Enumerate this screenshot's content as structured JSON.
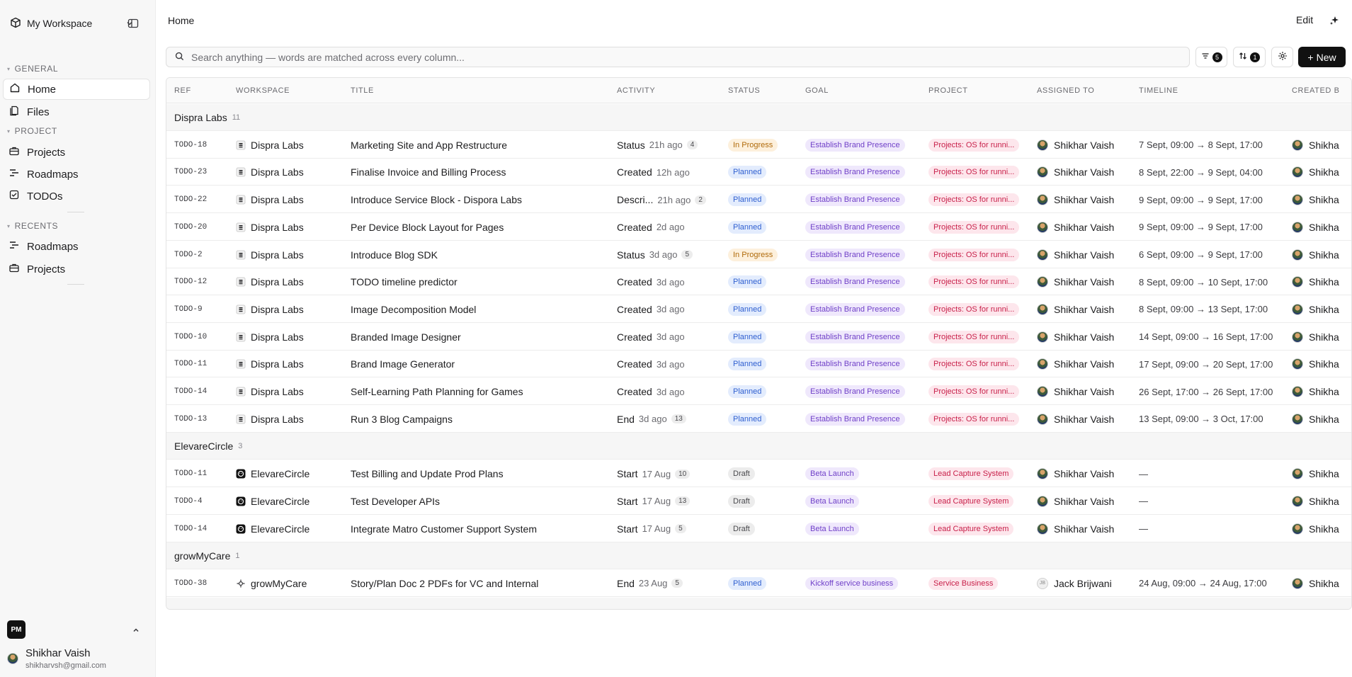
{
  "sidebar": {
    "workspace_name": "My Workspace",
    "sections": {
      "general": "GENERAL",
      "project": "PROJECT",
      "recents": "RECENTS"
    },
    "general_items": [
      {
        "label": "Home",
        "icon": "home-icon",
        "active": true
      },
      {
        "label": "Files",
        "icon": "files-icon"
      }
    ],
    "project_items": [
      {
        "label": "Projects",
        "icon": "briefcase-icon"
      },
      {
        "label": "Roadmaps",
        "icon": "roadmap-icon"
      },
      {
        "label": "TODOs",
        "icon": "checkbox-icon"
      }
    ],
    "recent_items": [
      {
        "label": "Roadmaps",
        "icon": "roadmap-icon"
      },
      {
        "label": "Projects",
        "icon": "briefcase-icon"
      }
    ],
    "org_badge": "PM",
    "user": {
      "name": "Shikhar Vaish",
      "email": "shikharvsh@gmail.com"
    }
  },
  "header": {
    "title": "Home",
    "edit_label": "Edit"
  },
  "toolbar": {
    "search_placeholder": "Search anything — words are matched across every column...",
    "filter_count": "5",
    "sort_count": "1",
    "new_label": "New"
  },
  "columns": {
    "ref": "REF",
    "workspace": "WORKSPACE",
    "title": "TITLE",
    "activity": "ACTIVITY",
    "status": "STATUS",
    "goal": "GOAL",
    "project": "PROJECT",
    "assigned": "ASSIGNED TO",
    "timeline": "TIMELINE",
    "created": "CREATED B"
  },
  "groups": [
    {
      "name": "Dispra Labs",
      "count": "11",
      "rows": [
        {
          "ref": "TODO-18",
          "workspace": "Dispra Labs",
          "title": "Marketing Site and App Restructure",
          "activity": "Status",
          "when": "21h ago",
          "n": "4",
          "status": "In Progress",
          "status_kind": "inprogress",
          "goal": "Establish Brand Presence",
          "project": "Projects: OS for runni...",
          "assigned": "Shikhar Vaish",
          "timeline": "7 Sept, 09:00 → 8 Sept, 17:00",
          "created": "Shikha"
        },
        {
          "ref": "TODO-23",
          "workspace": "Dispra Labs",
          "title": "Finalise Invoice and Billing Process",
          "activity": "Created",
          "when": "12h ago",
          "n": "",
          "status": "Planned",
          "status_kind": "planned",
          "goal": "Establish Brand Presence",
          "project": "Projects: OS for runni...",
          "assigned": "Shikhar Vaish",
          "timeline": "8 Sept, 22:00 → 9 Sept, 04:00",
          "created": "Shikha"
        },
        {
          "ref": "TODO-22",
          "workspace": "Dispra Labs",
          "title": "Introduce Service Block - Dispora Labs",
          "activity": "Descri...",
          "when": "21h ago",
          "n": "2",
          "status": "Planned",
          "status_kind": "planned",
          "goal": "Establish Brand Presence",
          "project": "Projects: OS for runni...",
          "assigned": "Shikhar Vaish",
          "timeline": "9 Sept, 09:00 → 9 Sept, 17:00",
          "created": "Shikha"
        },
        {
          "ref": "TODO-20",
          "workspace": "Dispra Labs",
          "title": "Per Device Block Layout for Pages",
          "activity": "Created",
          "when": "2d ago",
          "n": "",
          "status": "Planned",
          "status_kind": "planned",
          "goal": "Establish Brand Presence",
          "project": "Projects: OS for runni...",
          "assigned": "Shikhar Vaish",
          "timeline": "9 Sept, 09:00 → 9 Sept, 17:00",
          "created": "Shikha"
        },
        {
          "ref": "TODO-2",
          "workspace": "Dispra Labs",
          "title": "Introduce Blog SDK",
          "activity": "Status",
          "when": "3d ago",
          "n": "5",
          "status": "In Progress",
          "status_kind": "inprogress",
          "goal": "Establish Brand Presence",
          "project": "Projects: OS for runni...",
          "assigned": "Shikhar Vaish",
          "timeline": "6 Sept, 09:00 → 9 Sept, 17:00",
          "created": "Shikha"
        },
        {
          "ref": "TODO-12",
          "workspace": "Dispra Labs",
          "title": "TODO timeline predictor",
          "activity": "Created",
          "when": "3d ago",
          "n": "",
          "status": "Planned",
          "status_kind": "planned",
          "goal": "Establish Brand Presence",
          "project": "Projects: OS for runni...",
          "assigned": "Shikhar Vaish",
          "timeline": "8 Sept, 09:00 → 10 Sept, 17:00",
          "created": "Shikha"
        },
        {
          "ref": "TODO-9",
          "workspace": "Dispra Labs",
          "title": "Image Decomposition Model",
          "activity": "Created",
          "when": "3d ago",
          "n": "",
          "status": "Planned",
          "status_kind": "planned",
          "goal": "Establish Brand Presence",
          "project": "Projects: OS for runni...",
          "assigned": "Shikhar Vaish",
          "timeline": "8 Sept, 09:00 → 13 Sept, 17:00",
          "created": "Shikha"
        },
        {
          "ref": "TODO-10",
          "workspace": "Dispra Labs",
          "title": "Branded Image Designer",
          "activity": "Created",
          "when": "3d ago",
          "n": "",
          "status": "Planned",
          "status_kind": "planned",
          "goal": "Establish Brand Presence",
          "project": "Projects: OS for runni...",
          "assigned": "Shikhar Vaish",
          "timeline": "14 Sept, 09:00 → 16 Sept, 17:00",
          "created": "Shikha"
        },
        {
          "ref": "TODO-11",
          "workspace": "Dispra Labs",
          "title": "Brand Image Generator",
          "activity": "Created",
          "when": "3d ago",
          "n": "",
          "status": "Planned",
          "status_kind": "planned",
          "goal": "Establish Brand Presence",
          "project": "Projects: OS for runni...",
          "assigned": "Shikhar Vaish",
          "timeline": "17 Sept, 09:00 → 20 Sept, 17:00",
          "created": "Shikha"
        },
        {
          "ref": "TODO-14",
          "workspace": "Dispra Labs",
          "title": "Self-Learning Path Planning for Games",
          "activity": "Created",
          "when": "3d ago",
          "n": "",
          "status": "Planned",
          "status_kind": "planned",
          "goal": "Establish Brand Presence",
          "project": "Projects: OS for runni...",
          "assigned": "Shikhar Vaish",
          "timeline": "26 Sept, 17:00 → 26 Sept, 17:00",
          "created": "Shikha"
        },
        {
          "ref": "TODO-13",
          "workspace": "Dispra Labs",
          "title": "Run 3 Blog Campaigns",
          "activity": "End",
          "when": "3d ago",
          "n": "13",
          "status": "Planned",
          "status_kind": "planned",
          "goal": "Establish Brand Presence",
          "project": "Projects: OS for runni...",
          "assigned": "Shikhar Vaish",
          "timeline": "13 Sept, 09:00 → 3 Oct, 17:00",
          "created": "Shikha"
        }
      ]
    },
    {
      "name": "ElevareCircle",
      "count": "3",
      "rows": [
        {
          "ref": "TODO-11",
          "workspace": "ElevareCircle",
          "title": "Test Billing and Update Prod Plans",
          "activity": "Start",
          "when": "17 Aug",
          "n": "10",
          "status": "Draft",
          "status_kind": "draft",
          "goal": "Beta Launch",
          "project": "Lead Capture System",
          "assigned": "Shikhar Vaish",
          "timeline": "—",
          "created": "Shikha"
        },
        {
          "ref": "TODO-4",
          "workspace": "ElevareCircle",
          "title": "Test Developer APIs",
          "activity": "Start",
          "when": "17 Aug",
          "n": "13",
          "status": "Draft",
          "status_kind": "draft",
          "goal": "Beta Launch",
          "project": "Lead Capture System",
          "assigned": "Shikhar Vaish",
          "timeline": "—",
          "created": "Shikha"
        },
        {
          "ref": "TODO-14",
          "workspace": "ElevareCircle",
          "title": "Integrate Matro Customer Support System",
          "activity": "Start",
          "when": "17 Aug",
          "n": "5",
          "status": "Draft",
          "status_kind": "draft",
          "goal": "Beta Launch",
          "project": "Lead Capture System",
          "assigned": "Shikhar Vaish",
          "timeline": "—",
          "created": "Shikha"
        }
      ]
    },
    {
      "name": "growMyCare",
      "count": "1",
      "rows": [
        {
          "ref": "TODO-38",
          "workspace": "growMyCare",
          "title": "Story/Plan Doc 2 PDFs for VC and Internal",
          "activity": "End",
          "when": "23 Aug",
          "n": "5",
          "status": "Planned",
          "status_kind": "planned",
          "goal": "Kickoff service business",
          "project": "Service Business",
          "assigned": "Jack Brijwani",
          "assigned_initials": "JB",
          "timeline": "24 Aug, 09:00 → 24 Aug, 17:00",
          "created": "Shikha"
        }
      ]
    }
  ]
}
